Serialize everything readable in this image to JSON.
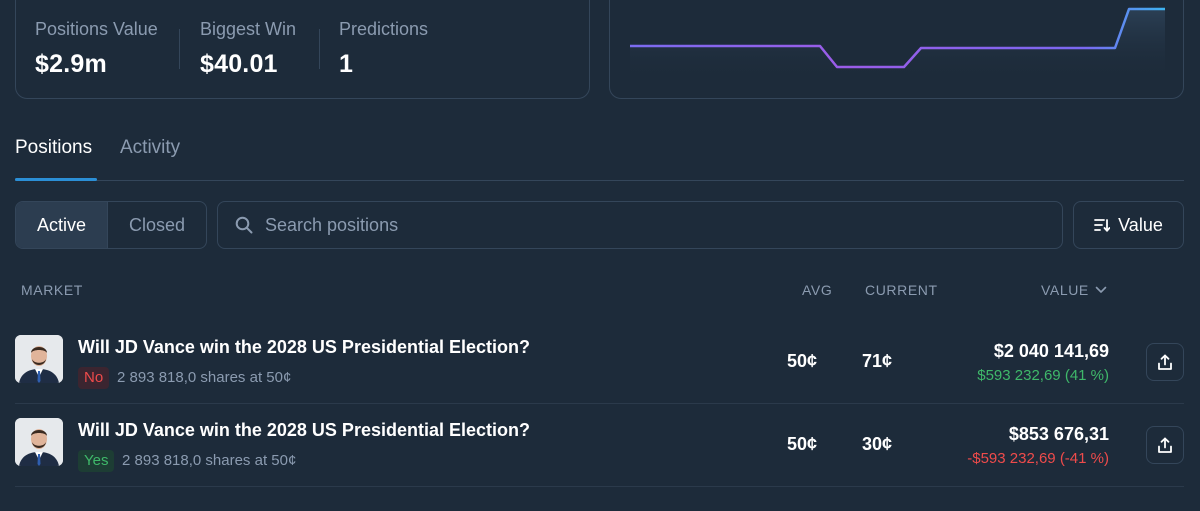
{
  "stats": [
    {
      "label": "Positions Value",
      "value": "$2.9m"
    },
    {
      "label": "Biggest Win",
      "value": "$40.01"
    },
    {
      "label": "Predictions",
      "value": "1"
    }
  ],
  "tabs": [
    {
      "label": "Positions",
      "active": true
    },
    {
      "label": "Activity",
      "active": false
    }
  ],
  "filter": {
    "active_label": "Active",
    "closed_label": "Closed"
  },
  "search": {
    "placeholder": "Search positions"
  },
  "sort": {
    "label": "Value"
  },
  "table": {
    "headers": {
      "market": "MARKET",
      "avg": "AVG",
      "current": "CURRENT",
      "value": "VALUE"
    },
    "rows": [
      {
        "title": "Will JD Vance win the 2028 US Presidential Election?",
        "outcome": "No",
        "shares": "2 893 818,0 shares at 50¢",
        "avg": "50¢",
        "current": "71¢",
        "value": "$2 040 141,69",
        "pnl": "$593 232,69 (41 %)"
      },
      {
        "title": "Will JD Vance win the 2028 US Presidential Election?",
        "outcome": "Yes",
        "shares": "2 893 818,0 shares at 50¢",
        "avg": "50¢",
        "current": "30¢",
        "value": "$853 676,31",
        "pnl": "-$593 232,69 (-41 %)"
      }
    ]
  },
  "colors": {
    "background": "#1d2b3a",
    "border": "#34465a",
    "muted_text": "#8b9bb0",
    "accent_blue": "#2b8fd6",
    "positive": "#3fb86a",
    "negative": "#ef4b4b"
  }
}
